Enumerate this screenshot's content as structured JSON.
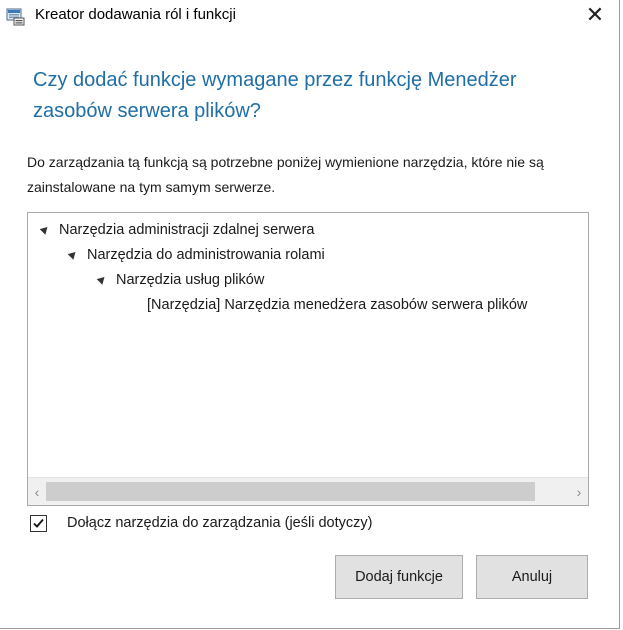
{
  "window": {
    "title": "Kreator dodawania ról i funkcji",
    "close_glyph": "✕"
  },
  "heading": "Czy dodać funkcje wymagane przez funkcję Menedżer zasobów serwera plików?",
  "description": "Do zarządzania tą funkcją są potrzebne poniżej wymienione narzędzia, które nie są zainstalowane na tym samym serwerze.",
  "tree": {
    "items": [
      {
        "label": "Narzędzia administracji zdalnej serwera",
        "level": 0,
        "expanded": true
      },
      {
        "label": "Narzędzia do administrowania rolami",
        "level": 1,
        "expanded": true
      },
      {
        "label": "Narzędzia usług plików",
        "level": 2,
        "expanded": true
      },
      {
        "label": "[Narzędzia] Narzędzia menedżera zasobów serwera plików",
        "level": 3,
        "expanded": null
      }
    ],
    "scroll_left_glyph": "‹",
    "scroll_right_glyph": "›"
  },
  "checkbox": {
    "label": "Dołącz narzędzia do zarządzania (jeśli dotyczy)",
    "checked": true
  },
  "buttons": {
    "add": "Dodaj funkcje",
    "cancel": "Anuluj"
  }
}
